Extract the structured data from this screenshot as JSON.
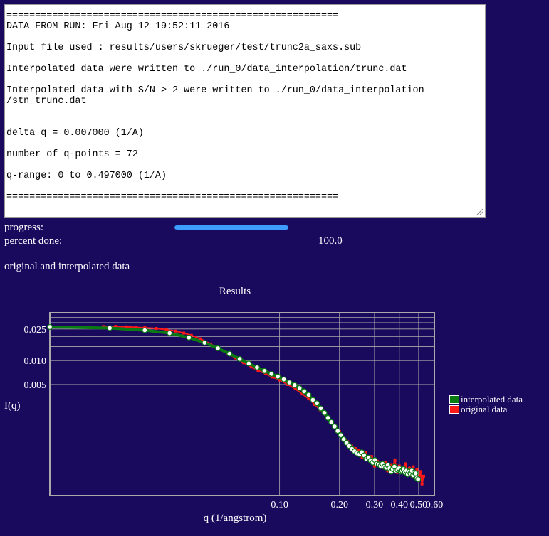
{
  "log": {
    "lines": [
      "==========================================================",
      "DATA FROM RUN: Fri Aug 12 19:52:11 2016",
      "",
      "Input file used : results/users/skrueger/test/trunc2a_saxs.sub",
      "",
      "Interpolated data were written to ./run_0/data_interpolation/trunc.dat",
      "",
      "Interpolated data with S/N > 2 were written to ./run_0/data_interpolation",
      "/stn_trunc.dat",
      "",
      "",
      "delta q = 0.007000 (1/A)",
      "",
      "number of q-points = 72",
      "",
      "q-range: 0 to 0.497000 (1/A)",
      "",
      "=========================================================="
    ]
  },
  "progress": {
    "label": "progress:",
    "fraction": 1.0,
    "percent_label": "percent done:",
    "percent_value": "100.0"
  },
  "section_label": "original and interpolated data",
  "chart_data": {
    "type": "scatter",
    "title": "Results",
    "xlabel": "q (1/angstrom)",
    "ylabel": "I(q)",
    "x_scale": "log",
    "y_scale": "log",
    "xlim": [
      0.007,
      0.6
    ],
    "ylim": [
      0.0002,
      0.04
    ],
    "x_ticks": [
      {
        "value": 0.1,
        "label": "0.10"
      },
      {
        "value": 0.2,
        "label": "0.20"
      },
      {
        "value": 0.3,
        "label": "0.30"
      },
      {
        "value": 0.4,
        "label": "0.40"
      },
      {
        "value": 0.5,
        "label": "0.50"
      },
      {
        "value": 0.6,
        "label": "0.60"
      }
    ],
    "y_ticks": [
      {
        "value": 0.025,
        "label": "0.025"
      },
      {
        "value": 0.01,
        "label": "0.010"
      },
      {
        "value": 0.005,
        "label": "0.005"
      }
    ],
    "grid": true,
    "legend_position": "right",
    "colors": {
      "background": "#1a0a5e",
      "interpolated": "#0a7a12",
      "original": "#ff1a1a",
      "marker": "#ffffff",
      "grid": "#aaaaaa"
    },
    "series": [
      {
        "name": "interpolated data",
        "x": [
          0.007,
          0.014,
          0.021,
          0.028,
          0.035,
          0.042,
          0.049,
          0.056,
          0.063,
          0.07,
          0.077,
          0.084,
          0.091,
          0.098,
          0.105,
          0.112,
          0.119,
          0.126,
          0.133,
          0.14,
          0.147,
          0.154,
          0.161,
          0.168,
          0.175,
          0.182,
          0.189,
          0.196,
          0.203,
          0.21,
          0.217,
          0.224,
          0.231,
          0.238,
          0.245,
          0.252,
          0.259,
          0.266,
          0.273,
          0.28,
          0.287,
          0.294,
          0.301,
          0.308,
          0.315,
          0.322,
          0.329,
          0.336,
          0.343,
          0.35,
          0.357,
          0.364,
          0.371,
          0.378,
          0.385,
          0.392,
          0.399,
          0.406,
          0.413,
          0.42,
          0.427,
          0.434,
          0.441,
          0.448,
          0.455,
          0.462,
          0.469,
          0.476,
          0.483,
          0.49,
          0.497
        ],
        "y": [
          0.0265,
          0.0257,
          0.0241,
          0.0222,
          0.0195,
          0.0168,
          0.0143,
          0.0122,
          0.0105,
          0.0092,
          0.0082,
          0.0074,
          0.0068,
          0.0063,
          0.0058,
          0.0053,
          0.0049,
          0.0045,
          0.0041,
          0.0037,
          0.0032,
          0.0029,
          0.0025,
          0.0022,
          0.0019,
          0.00168,
          0.00148,
          0.0013,
          0.00115,
          0.00102,
          0.00092,
          0.00084,
          0.00077,
          0.00072,
          0.00068,
          0.00066,
          0.0007,
          0.00064,
          0.00058,
          0.0006,
          0.00055,
          0.00052,
          0.00056,
          0.0005,
          0.00049,
          0.00047,
          0.0005,
          0.00046,
          0.00045,
          0.00048,
          0.00044,
          0.0004,
          0.00043,
          0.00046,
          0.00041,
          0.00042,
          0.00044,
          0.0004,
          0.00041,
          0.00043,
          0.00039,
          0.00041,
          0.00037,
          0.0004,
          0.00038,
          0.00041,
          0.00036,
          0.00039,
          0.00038,
          0.00033,
          0.00032
        ]
      },
      {
        "name": "original data",
        "x": [
          0.013,
          0.015,
          0.017,
          0.019,
          0.021,
          0.024,
          0.027,
          0.03,
          0.033,
          0.036,
          0.04,
          0.045,
          0.05,
          0.055,
          0.06,
          0.066,
          0.072,
          0.078,
          0.085,
          0.092,
          0.1,
          0.11,
          0.12,
          0.13,
          0.14,
          0.15,
          0.16,
          0.17,
          0.18,
          0.19,
          0.2,
          0.21,
          0.22,
          0.23,
          0.24,
          0.25,
          0.26,
          0.27,
          0.28,
          0.29,
          0.3,
          0.31,
          0.32,
          0.33,
          0.34,
          0.35,
          0.36,
          0.37,
          0.38,
          0.39,
          0.4,
          0.41,
          0.42,
          0.43,
          0.44,
          0.45,
          0.46,
          0.47,
          0.48,
          0.49,
          0.5,
          0.51,
          0.52,
          0.53
        ],
        "y": [
          0.0268,
          0.027,
          0.0266,
          0.0262,
          0.0259,
          0.0254,
          0.0245,
          0.0235,
          0.0222,
          0.0208,
          0.0188,
          0.0162,
          0.014,
          0.0122,
          0.0108,
          0.0094,
          0.0083,
          0.0075,
          0.0068,
          0.0062,
          0.0057,
          0.005,
          0.0044,
          0.0038,
          0.0033,
          0.0028,
          0.0024,
          0.0021,
          0.00175,
          0.0015,
          0.00128,
          0.00108,
          0.00095,
          0.00084,
          0.00078,
          0.00074,
          0.0006,
          0.00069,
          0.00056,
          0.00062,
          0.00047,
          0.00054,
          0.00051,
          0.00045,
          0.00052,
          0.00041,
          0.00048,
          0.00046,
          0.00055,
          0.00039,
          0.00047,
          0.0004,
          0.00045,
          0.0005,
          0.00037,
          0.00044,
          0.00036,
          0.00046,
          0.00034,
          0.00042,
          0.00031,
          0.0004,
          0.00028,
          0.00035
        ]
      }
    ]
  }
}
